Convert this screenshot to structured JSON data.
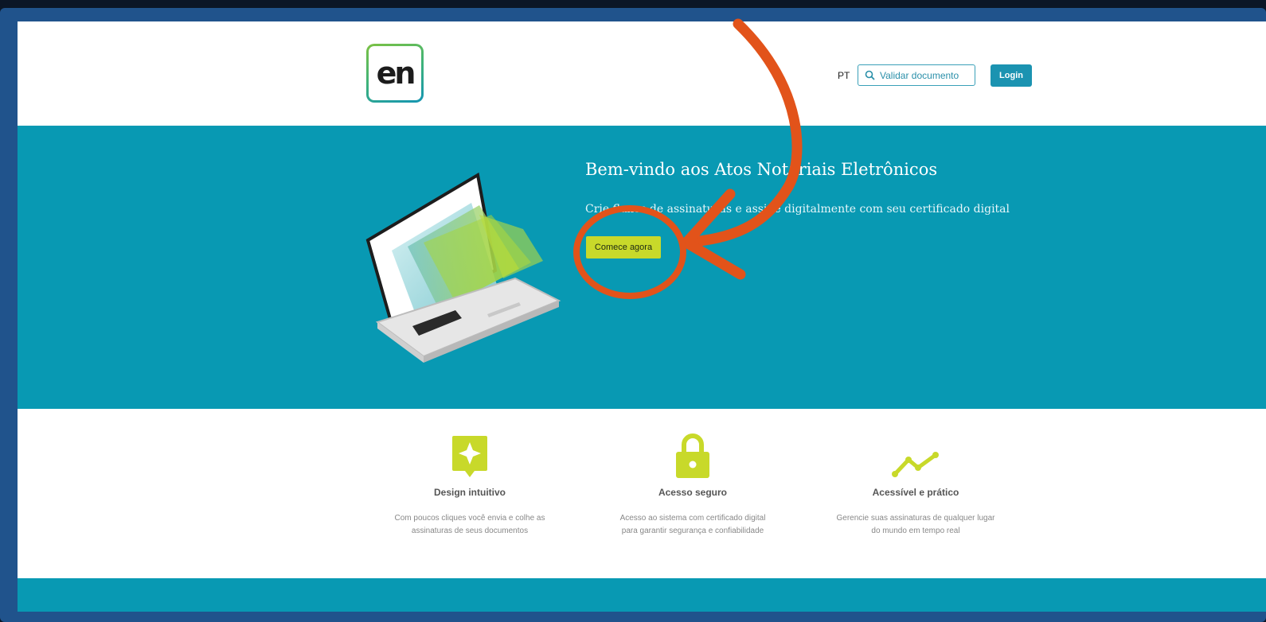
{
  "header": {
    "logo_text": "en",
    "language": "PT",
    "validate_placeholder": "Validar documento",
    "login_label": "Login"
  },
  "hero": {
    "title": "Bem-vindo aos Atos Notariais Eletrônicos",
    "subtitle": "Crie fluxos de assinaturas e assine digitalmente com seu certificado digital",
    "cta_label": "Comece agora"
  },
  "features": [
    {
      "icon": "sparkle-badge-icon",
      "title": "Design intuitivo",
      "description": "Com poucos cliques você envia e colhe as assinaturas de seus documentos"
    },
    {
      "icon": "lock-icon",
      "title": "Acesso seguro",
      "description": "Acesso ao sistema com certificado digital para garantir segurança e confiabilidade"
    },
    {
      "icon": "trend-line-icon",
      "title": "Acessível e prático",
      "description": "Gerencie suas assinaturas de qualquer lugar do mundo em tempo real"
    }
  ],
  "colors": {
    "primary": "#0899b3",
    "accent": "#c8d92a",
    "annotation": "#e2531a",
    "frame": "#20538c"
  }
}
